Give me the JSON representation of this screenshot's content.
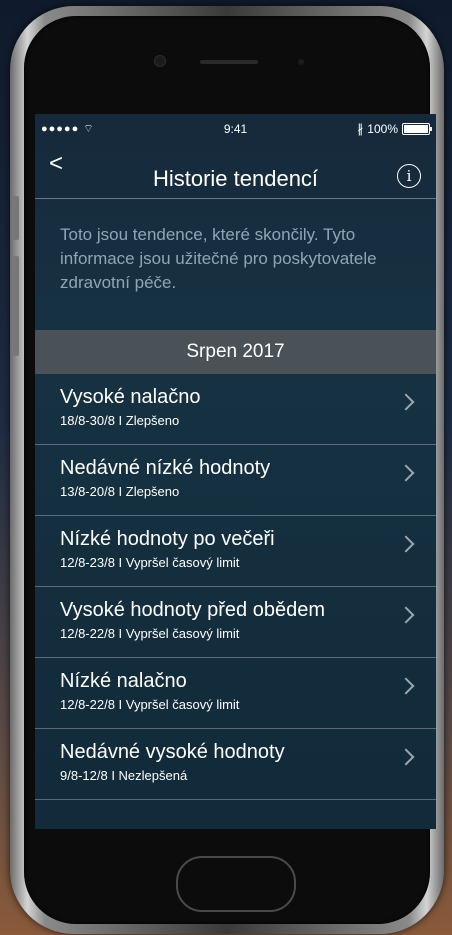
{
  "status": {
    "signal": "●●●●● ",
    "wifi": "⌔",
    "time": "9:41",
    "bluetooth": "∦",
    "battery_text": "100%"
  },
  "nav": {
    "back": "<",
    "title": "Historie tendencí",
    "info": "i"
  },
  "description": "Toto jsou tendence, které skončily. Tyto informace jsou užitečné pro poskytovatele zdravotní péče.",
  "section": {
    "title": "Srpen 2017"
  },
  "items": [
    {
      "name": "Vysoké nalačno",
      "detail": "18/8-30/8  I  Zlepšeno"
    },
    {
      "name": "Nedávné nízké hodnoty",
      "detail": "13/8-20/8  I  Zlepšeno"
    },
    {
      "name": "Nízké hodnoty po večeři",
      "detail": "12/8-23/8  I  Vypršel časový limit"
    },
    {
      "name": "Vysoké hodnoty před obědem",
      "detail": "12/8-22/8  I  Vypršel časový limit"
    },
    {
      "name": "Nízké nalačno",
      "detail": "12/8-22/8  I Vypršel časový limit"
    },
    {
      "name": "Nedávné vysoké hodnoty",
      "detail": "9/8-12/8  I  Nezlepšená"
    }
  ]
}
